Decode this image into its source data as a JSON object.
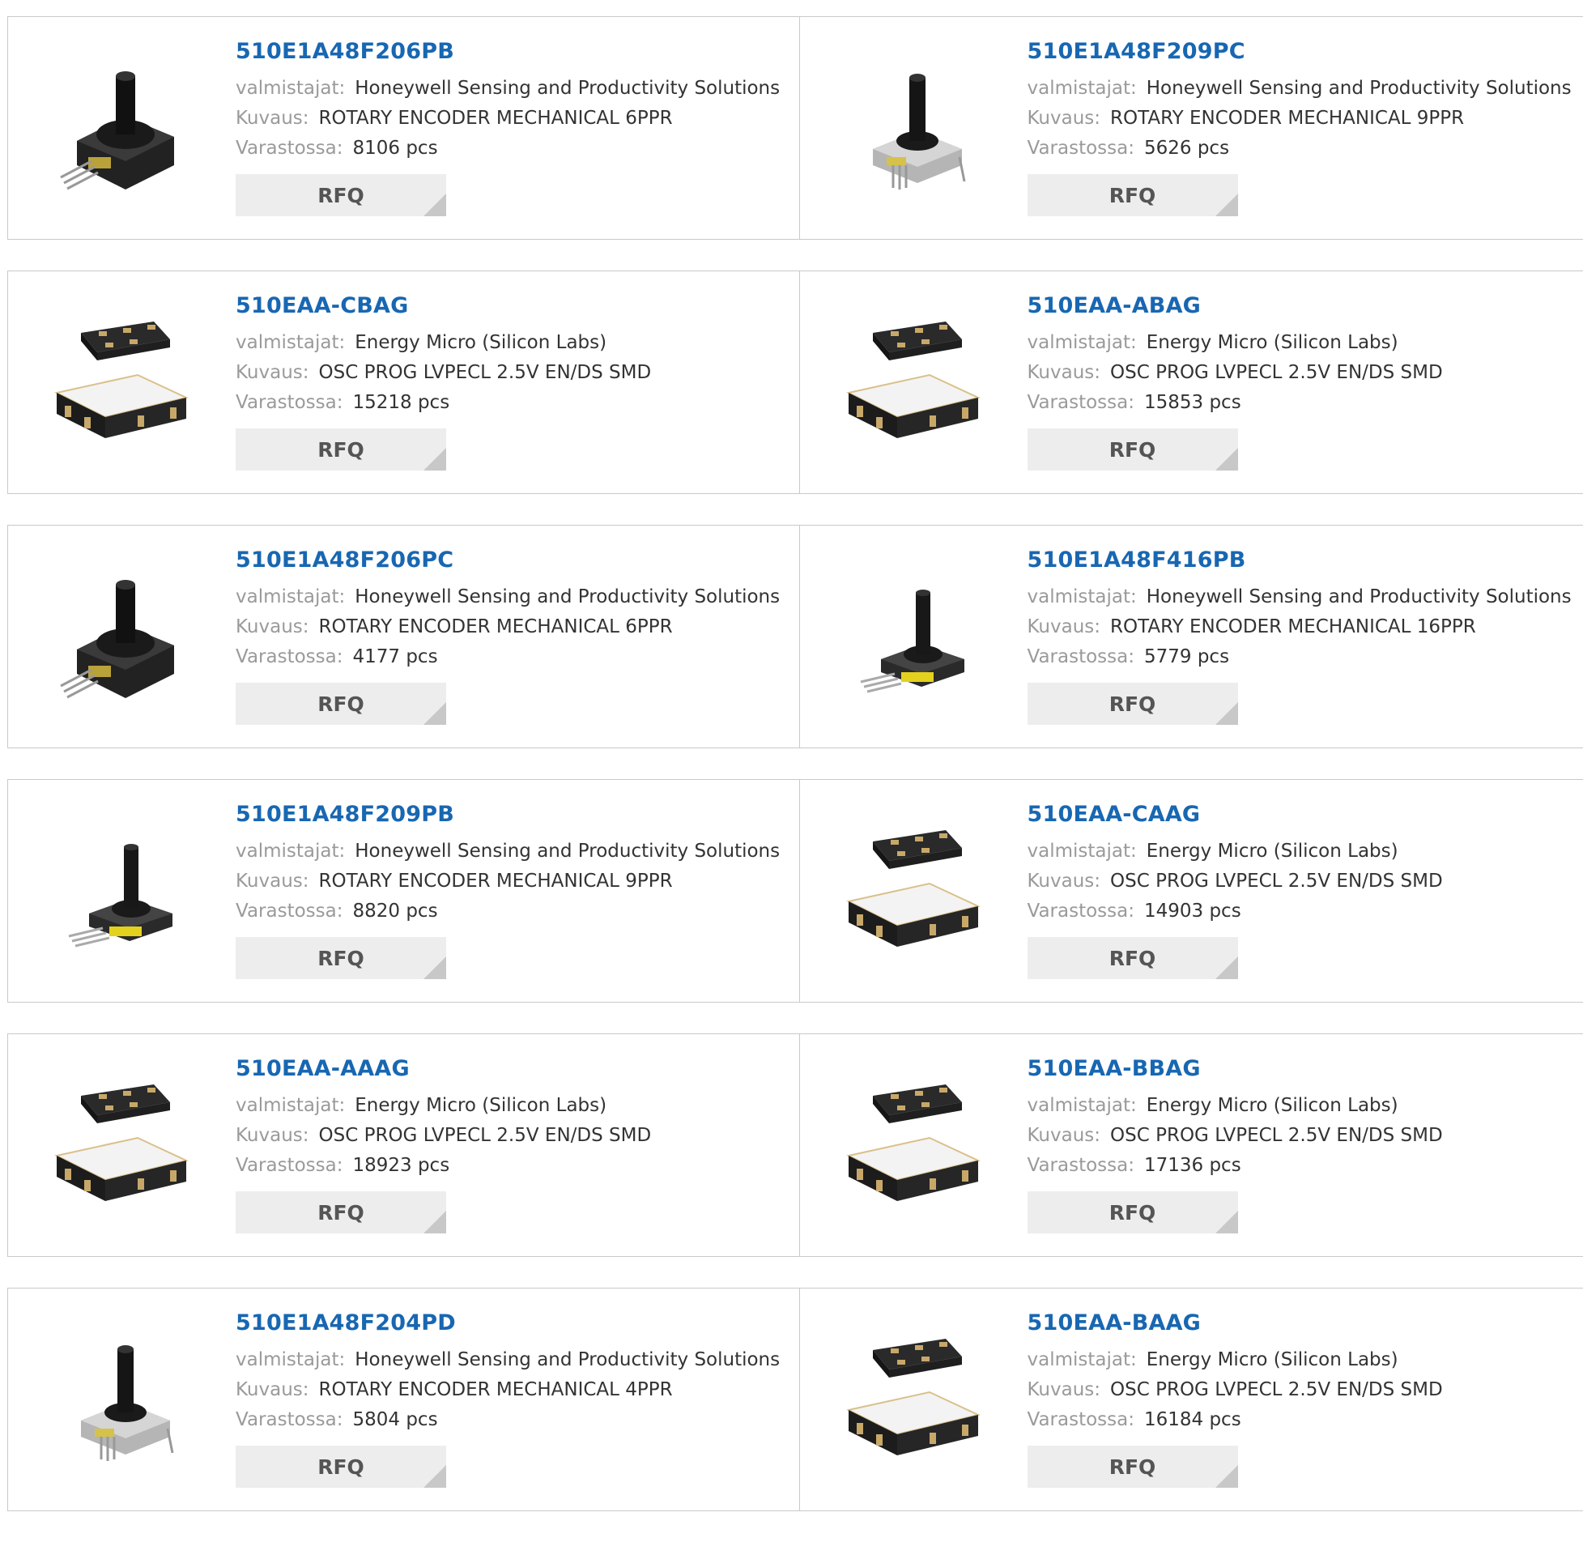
{
  "labels": {
    "manufacturer": "valmistajat:",
    "description": "Kuvaus:",
    "stock": "Varastossa:",
    "rfq": "RFQ"
  },
  "rows": [
    {
      "cards": [
        {
          "part": "510E1A48F206PB",
          "manufacturer": "Honeywell Sensing and Productivity Solutions",
          "description": "ROTARY ENCODER MECHANICAL 6PPR",
          "stock": "8106 pcs",
          "image": "rotary-encoder-large"
        },
        {
          "part": "510E1A48F209PC",
          "manufacturer": "Honeywell Sensing and Productivity Solutions",
          "description": "ROTARY ENCODER MECHANICAL 9PPR",
          "stock": "5626 pcs",
          "image": "rotary-encoder-metal"
        }
      ]
    },
    {
      "cards": [
        {
          "part": "510EAA-CBAG",
          "manufacturer": "Energy Micro (Silicon Labs)",
          "description": "OSC PROG LVPECL 2.5V EN/DS SMD",
          "stock": "15218 pcs",
          "image": "smd-oscillator"
        },
        {
          "part": "510EAA-ABAG",
          "manufacturer": "Energy Micro (Silicon Labs)",
          "description": "OSC PROG LVPECL 2.5V EN/DS SMD",
          "stock": "15853 pcs",
          "image": "smd-oscillator"
        }
      ]
    },
    {
      "cards": [
        {
          "part": "510E1A48F206PC",
          "manufacturer": "Honeywell Sensing and Productivity Solutions",
          "description": "ROTARY ENCODER MECHANICAL 6PPR",
          "stock": "4177 pcs",
          "image": "rotary-encoder-large"
        },
        {
          "part": "510E1A48F416PB",
          "manufacturer": "Honeywell Sensing and Productivity Solutions",
          "description": "ROTARY ENCODER MECHANICAL 16PPR",
          "stock": "5779 pcs",
          "image": "rotary-encoder-small"
        }
      ]
    },
    {
      "cards": [
        {
          "part": "510E1A48F209PB",
          "manufacturer": "Honeywell Sensing and Productivity Solutions",
          "description": "ROTARY ENCODER MECHANICAL 9PPR",
          "stock": "8820 pcs",
          "image": "rotary-encoder-small"
        },
        {
          "part": "510EAA-CAAG",
          "manufacturer": "Energy Micro (Silicon Labs)",
          "description": "OSC PROG LVPECL 2.5V EN/DS SMD",
          "stock": "14903 pcs",
          "image": "smd-oscillator"
        }
      ]
    },
    {
      "cards": [
        {
          "part": "510EAA-AAAG",
          "manufacturer": "Energy Micro (Silicon Labs)",
          "description": "OSC PROG LVPECL 2.5V EN/DS SMD",
          "stock": "18923 pcs",
          "image": "smd-oscillator"
        },
        {
          "part": "510EAA-BBAG",
          "manufacturer": "Energy Micro (Silicon Labs)",
          "description": "OSC PROG LVPECL 2.5V EN/DS SMD",
          "stock": "17136 pcs",
          "image": "smd-oscillator"
        }
      ]
    },
    {
      "cards": [
        {
          "part": "510E1A48F204PD",
          "manufacturer": "Honeywell Sensing and Productivity Solutions",
          "description": "ROTARY ENCODER MECHANICAL 4PPR",
          "stock": "5804 pcs",
          "image": "rotary-encoder-metal"
        },
        {
          "part": "510EAA-BAAG",
          "manufacturer": "Energy Micro (Silicon Labs)",
          "description": "OSC PROG LVPECL 2.5V EN/DS SMD",
          "stock": "16184 pcs",
          "image": "smd-oscillator"
        }
      ]
    }
  ],
  "colors": {
    "link": "#1867b2",
    "label": "#9a9a9a",
    "border": "#c9c9c9",
    "button": "#ededed"
  }
}
